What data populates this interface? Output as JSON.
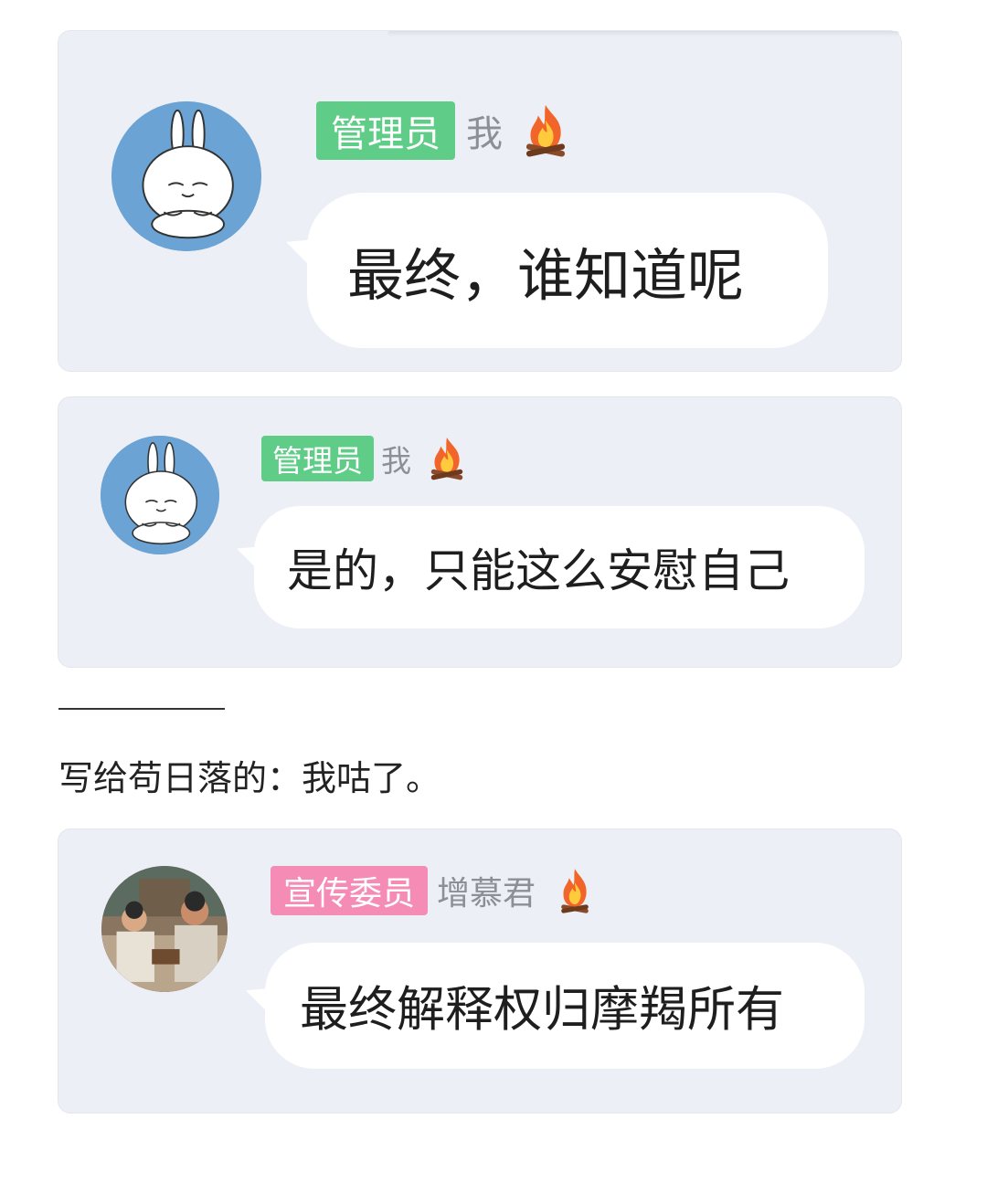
{
  "messages": [
    {
      "role": "管理员",
      "role_color": "#5fcc87",
      "username": "我",
      "flair_icon": "fire-icon",
      "text": "最终，谁知道呢",
      "avatar": "rabbit-avatar"
    },
    {
      "role": "管理员",
      "role_color": "#5fcc87",
      "username": "我",
      "flair_icon": "fire-icon",
      "text": "是的，只能这么安慰自己",
      "avatar": "rabbit-avatar"
    },
    {
      "role": "宣传委员",
      "role_color": "#f58cb6",
      "username": "增慕君",
      "flair_icon": "fire-icon",
      "text": "最终解释权归摩羯所有",
      "avatar": "photo-avatar"
    }
  ],
  "divider": "————",
  "note": "写给苟日落的：我咕了。",
  "colors": {
    "card_bg": "#eceff5",
    "bubble_bg": "#ffffff",
    "avatar_blue": "#6aa3d4"
  }
}
